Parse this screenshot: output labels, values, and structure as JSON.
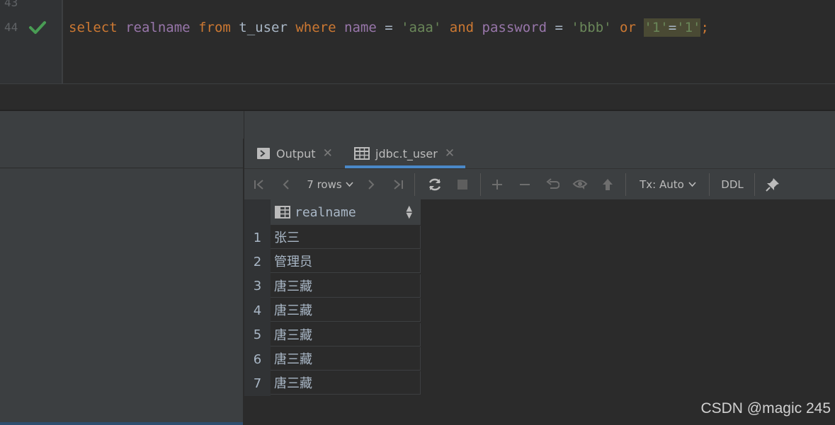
{
  "editor": {
    "line_numbers": [
      "43",
      "44"
    ],
    "code_tokens": [
      {
        "t": "select",
        "c": "kw"
      },
      {
        "t": " ",
        "c": ""
      },
      {
        "t": "realname",
        "c": "id"
      },
      {
        "t": " ",
        "c": ""
      },
      {
        "t": "from",
        "c": "kw"
      },
      {
        "t": " t_user ",
        "c": ""
      },
      {
        "t": "where",
        "c": "kw"
      },
      {
        "t": " ",
        "c": ""
      },
      {
        "t": "name",
        "c": "id"
      },
      {
        "t": " = ",
        "c": ""
      },
      {
        "t": "'aaa'",
        "c": "str"
      },
      {
        "t": " ",
        "c": ""
      },
      {
        "t": "and",
        "c": "kw"
      },
      {
        "t": " ",
        "c": ""
      },
      {
        "t": "password",
        "c": "id"
      },
      {
        "t": " = ",
        "c": ""
      },
      {
        "t": "'bbb'",
        "c": "str"
      },
      {
        "t": " ",
        "c": ""
      },
      {
        "t": "or",
        "c": "kw"
      },
      {
        "t": " ",
        "c": ""
      }
    ],
    "code_highlight": {
      "left": "'1'",
      "op": "=",
      "right": "'1'"
    },
    "code_end": ";"
  },
  "tabs": {
    "output_label": "Output",
    "result_label": "jdbc.t_user"
  },
  "toolbar": {
    "rows_label": "7 rows",
    "tx_label": "Tx: Auto",
    "ddl_label": "DDL"
  },
  "grid": {
    "column": "realname",
    "rows": [
      {
        "n": "1",
        "v": "张三"
      },
      {
        "n": "2",
        "v": "管理员"
      },
      {
        "n": "3",
        "v": "唐三藏"
      },
      {
        "n": "4",
        "v": "唐三藏"
      },
      {
        "n": "5",
        "v": "唐三藏"
      },
      {
        "n": "6",
        "v": "唐三藏"
      },
      {
        "n": "7",
        "v": "唐三藏"
      }
    ]
  },
  "watermark": "CSDN @magic 245",
  "colors": {
    "keyword": "#cc7832",
    "identifier": "#9876aa",
    "string": "#6a8759",
    "check": "#499c54",
    "tab_accent": "#4a88c7"
  }
}
